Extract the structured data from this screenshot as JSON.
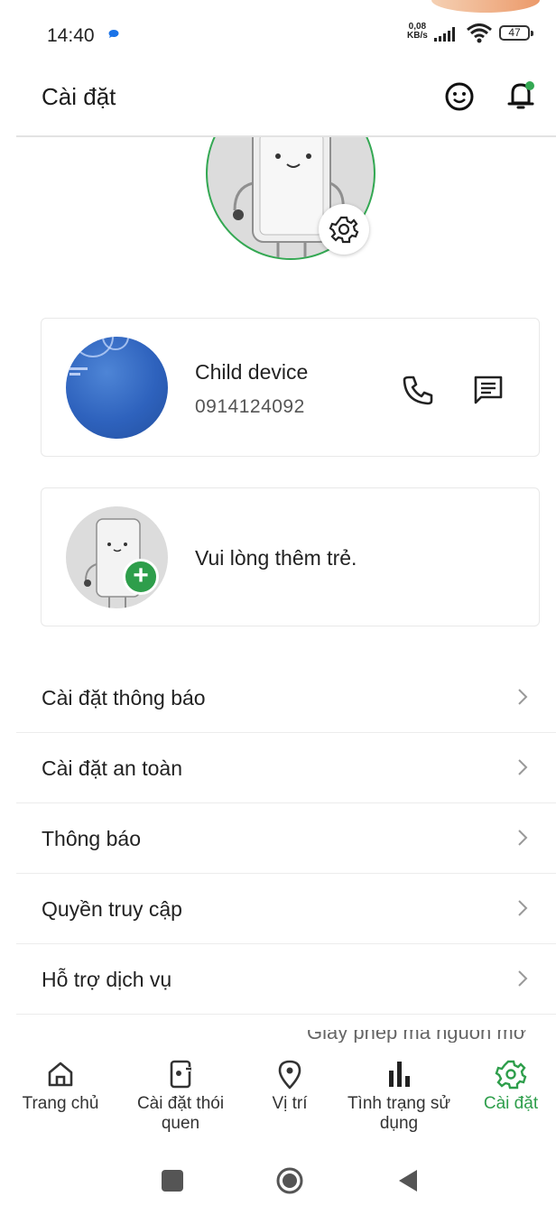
{
  "status_bar": {
    "time": "14:40",
    "net_speed_value": "0,08",
    "net_speed_unit": "KB/s",
    "battery": "47"
  },
  "header": {
    "title": "Cài đặt"
  },
  "child_device": {
    "name": "Child device",
    "phone": "0914124092"
  },
  "add_child": {
    "text": "Vui lòng thêm trẻ."
  },
  "menu": {
    "items": [
      {
        "label": "Cài đặt thông báo"
      },
      {
        "label": "Cài đặt an toàn"
      },
      {
        "label": "Thông báo"
      },
      {
        "label": "Quyền truy cập"
      },
      {
        "label": "Hỗ trợ dịch vụ"
      }
    ],
    "partial_item": "Giấy phép mã nguồn mở"
  },
  "bottom_nav": {
    "items": [
      {
        "label": "Trang chủ",
        "icon": "home-icon"
      },
      {
        "label": "Cài đặt thói quen",
        "icon": "phone-settings-icon"
      },
      {
        "label": "Vị trí",
        "icon": "location-pin-icon"
      },
      {
        "label": "Tình trạng sử dụng",
        "icon": "bar-chart-icon"
      },
      {
        "label": "Cài đặt",
        "icon": "gear-icon",
        "active": true
      }
    ]
  },
  "colors": {
    "accent": "#2e9e4b",
    "notification_dot": "#34a853"
  }
}
